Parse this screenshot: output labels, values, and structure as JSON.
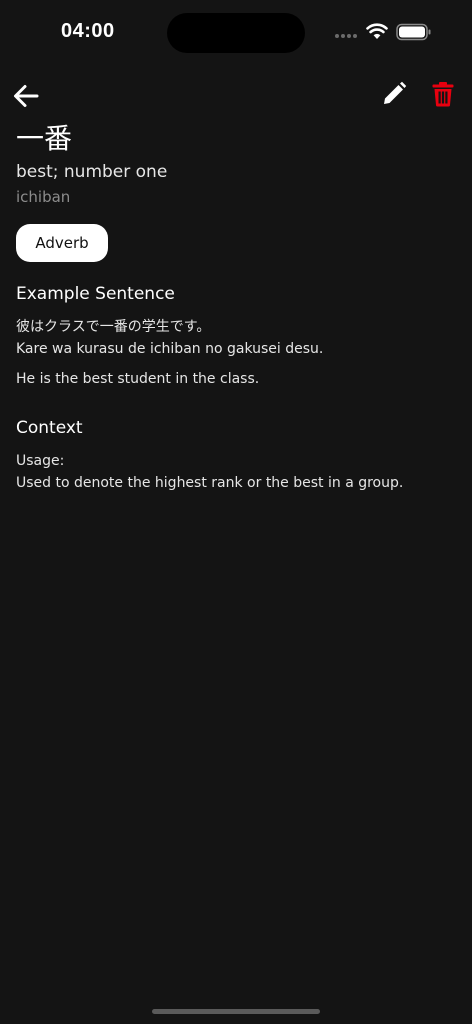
{
  "status_bar": {
    "time": "04:00"
  },
  "nav": {
    "back_icon": "arrow-left-icon",
    "edit_icon": "pencil-icon",
    "delete_icon": "trash-icon",
    "delete_color": "#e8000f"
  },
  "word": {
    "kanji": "一番",
    "meaning": "best; number one",
    "romaji": "ichiban",
    "part_of_speech": "Adverb"
  },
  "example": {
    "heading": "Example Sentence",
    "japanese": "彼はクラスで一番の学生です。",
    "romaji": "Kare wa kurasu de ichiban no gakusei desu.",
    "english": "He is the best student in the class."
  },
  "context": {
    "heading": "Context",
    "usage_label": "Usage:",
    "usage_text": "Used to denote the highest rank or the best in a group."
  }
}
